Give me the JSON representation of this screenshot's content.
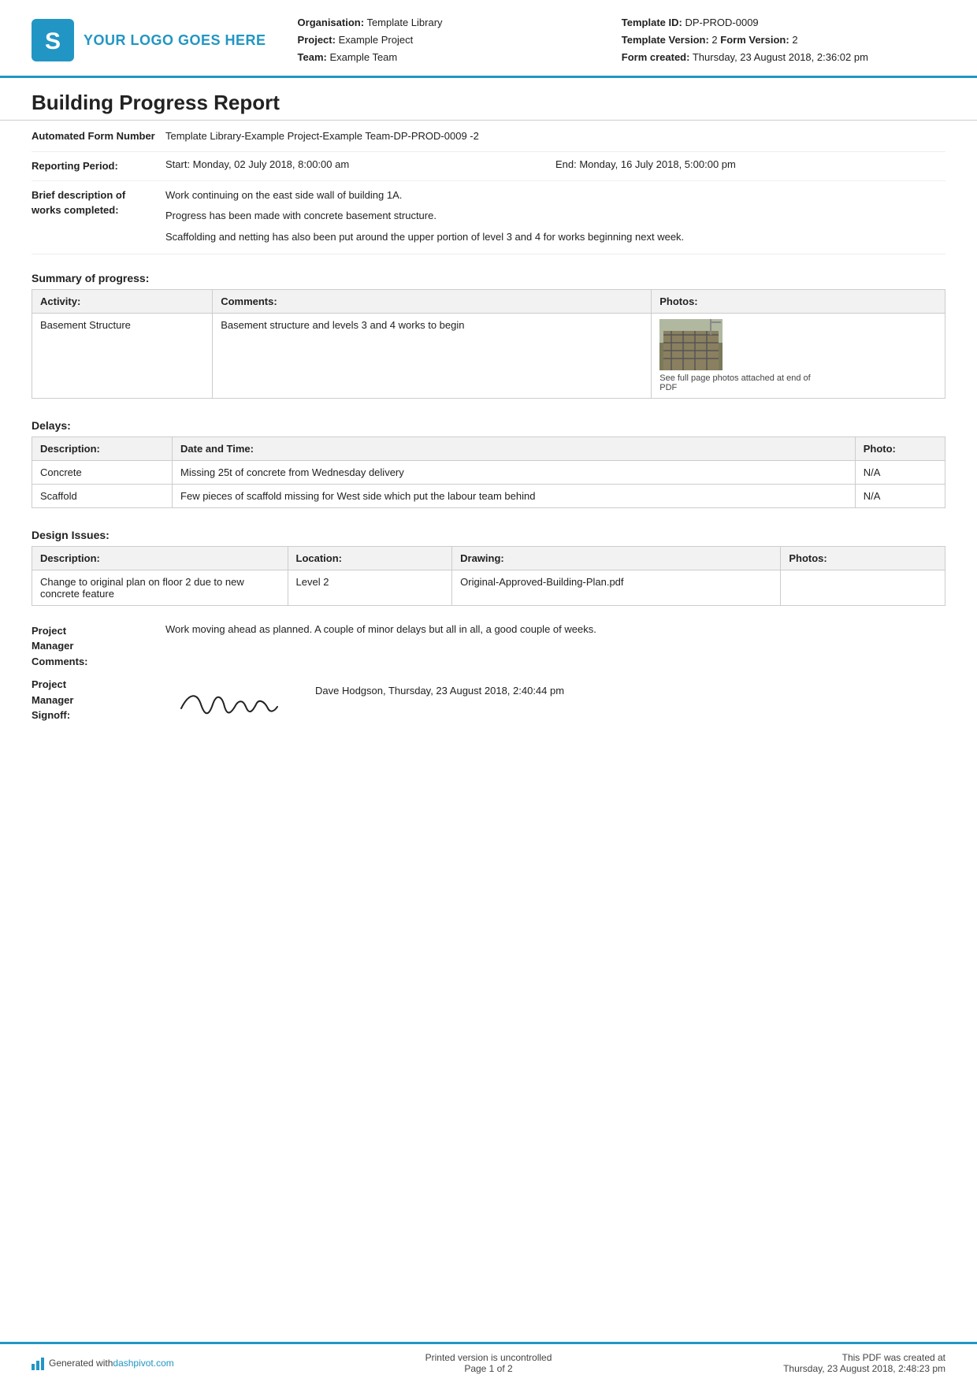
{
  "header": {
    "logo_text": "YOUR LOGO GOES HERE",
    "org_label": "Organisation:",
    "org_value": "Template Library",
    "project_label": "Project:",
    "project_value": "Example Project",
    "team_label": "Team:",
    "team_value": "Example Team",
    "template_id_label": "Template ID:",
    "template_id_value": "DP-PROD-0009",
    "template_version_label": "Template Version:",
    "template_version_value": "2",
    "form_version_label": "Form Version:",
    "form_version_value": "2",
    "form_created_label": "Form created:",
    "form_created_value": "Thursday, 23 August 2018, 2:36:02 pm"
  },
  "report": {
    "title": "Building Progress Report"
  },
  "fields": {
    "form_number_label": "Automated Form Number",
    "form_number_value": "Template Library-Example Project-Example Team-DP-PROD-0009   -2",
    "reporting_period_label": "Reporting Period:",
    "reporting_start": "Start: Monday, 02 July 2018, 8:00:00 am",
    "reporting_end": "End: Monday, 16 July 2018, 5:00:00 pm",
    "brief_description_label": "Brief description of works completed:",
    "brief_description_lines": [
      "Work continuing on the east side wall of building 1A.",
      "Progress has been made with concrete basement structure.",
      "Scaffolding and netting has also been put around the upper portion of level 3 and 4 for works beginning next week."
    ]
  },
  "summary": {
    "title": "Summary of progress:",
    "columns": [
      "Activity:",
      "Comments:",
      "Photos:"
    ],
    "rows": [
      {
        "activity": "Basement Structure",
        "comments": "Basement structure and levels 3 and 4 works to begin",
        "photo_caption": "See full page photos attached at end of PDF"
      }
    ]
  },
  "delays": {
    "title": "Delays:",
    "columns": [
      "Description:",
      "Date and Time:",
      "Photo:"
    ],
    "rows": [
      {
        "description": "Concrete",
        "date_time": "Missing 25t of concrete from Wednesday delivery",
        "photo": "N/A"
      },
      {
        "description": "Scaffold",
        "date_time": "Few pieces of scaffold missing for West side which put the labour team behind",
        "photo": "N/A"
      }
    ]
  },
  "design_issues": {
    "title": "Design Issues:",
    "columns": [
      "Description:",
      "Location:",
      "Drawing:",
      "Photos:"
    ],
    "rows": [
      {
        "description": "Change to original plan on floor 2 due to new concrete feature",
        "location": "Level 2",
        "drawing": "Original-Approved-Building-Plan.pdf",
        "photos": ""
      }
    ]
  },
  "pm": {
    "comments_label": "Project Manager Comments:",
    "comments_value": "Work moving ahead as planned. A couple of minor delays but all in all, a good couple of weeks.",
    "signoff_label": "Project Manager Signoff:",
    "signoff_name": "Dave Hodgson, Thursday, 23 August 2018, 2:40:44 pm"
  },
  "footer": {
    "generated_text": "Generated with ",
    "generated_link": "dashpivot.com",
    "center_text_line1": "Printed version is uncontrolled",
    "center_text_line2": "Page 1 of 2",
    "right_text_line1": "This PDF was created at",
    "right_text_line2": "Thursday, 23 August 2018, 2:48:23 pm"
  }
}
